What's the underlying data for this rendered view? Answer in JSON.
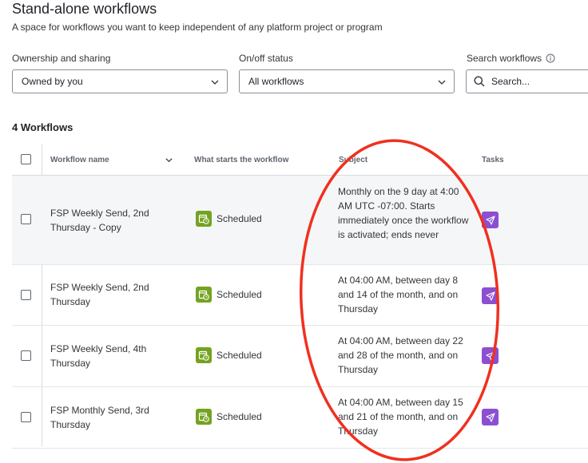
{
  "header": {
    "title": "Stand-alone workflows",
    "description": "A space for workflows you want to keep independent of any platform project or program"
  },
  "filters": {
    "ownership": {
      "label": "Ownership and sharing",
      "value": "Owned by you"
    },
    "status": {
      "label": "On/off status",
      "value": "All workflows"
    },
    "search": {
      "label": "Search workflows",
      "placeholder": "Search..."
    }
  },
  "table": {
    "count_title": "4 Workflows",
    "columns": {
      "name": "Workflow name",
      "trigger": "What starts the workflow",
      "subject": "Subject",
      "tasks": "Tasks"
    },
    "rows": [
      {
        "name": "FSP Weekly Send, 2nd Thursday - Copy",
        "trigger": "Scheduled",
        "subject": "Monthly on the 9 day at 4:00 AM UTC -07:00. Starts immediately once the workflow is activated; ends never",
        "task_icon": "send-icon"
      },
      {
        "name": "FSP Weekly Send, 2nd Thursday",
        "trigger": "Scheduled",
        "subject": "At 04:00 AM, between day 8 and 14 of the month, and on Thursday",
        "task_icon": "send-icon"
      },
      {
        "name": "FSP Weekly Send, 4th Thursday",
        "trigger": "Scheduled",
        "subject": "At 04:00 AM, between day 22 and 28 of the month, and on Thursday",
        "task_icon": "send-icon"
      },
      {
        "name": "FSP Monthly Send, 3rd Thursday",
        "trigger": "Scheduled",
        "subject": "At 04:00 AM, between day 15 and 21 of the month, and on Thursday",
        "task_icon": "send-icon"
      }
    ]
  },
  "colors": {
    "scheduled_green": "#73a321",
    "task_purple": "#8c4fd1",
    "annotation_red": "#f0301f"
  }
}
